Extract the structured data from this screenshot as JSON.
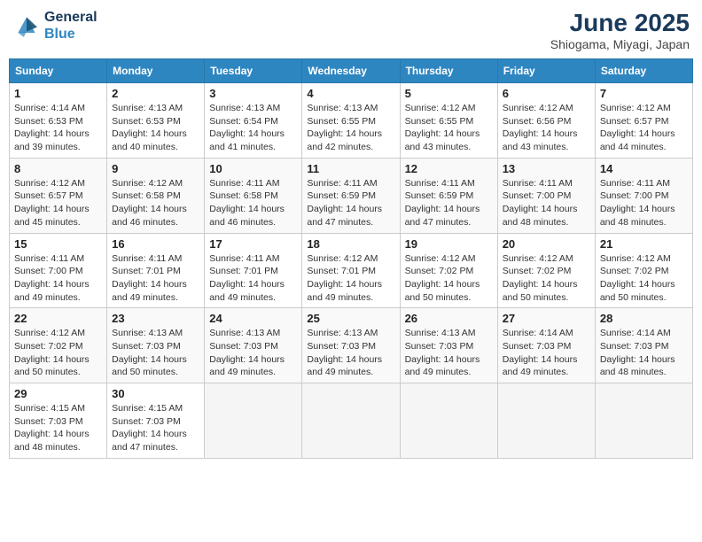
{
  "header": {
    "logo_line1": "General",
    "logo_line2": "Blue",
    "title": "June 2025",
    "subtitle": "Shiogama, Miyagi, Japan"
  },
  "days_of_week": [
    "Sunday",
    "Monday",
    "Tuesday",
    "Wednesday",
    "Thursday",
    "Friday",
    "Saturday"
  ],
  "weeks": [
    [
      {
        "day": "1",
        "info": "Sunrise: 4:14 AM\nSunset: 6:53 PM\nDaylight: 14 hours\nand 39 minutes."
      },
      {
        "day": "2",
        "info": "Sunrise: 4:13 AM\nSunset: 6:53 PM\nDaylight: 14 hours\nand 40 minutes."
      },
      {
        "day": "3",
        "info": "Sunrise: 4:13 AM\nSunset: 6:54 PM\nDaylight: 14 hours\nand 41 minutes."
      },
      {
        "day": "4",
        "info": "Sunrise: 4:13 AM\nSunset: 6:55 PM\nDaylight: 14 hours\nand 42 minutes."
      },
      {
        "day": "5",
        "info": "Sunrise: 4:12 AM\nSunset: 6:55 PM\nDaylight: 14 hours\nand 43 minutes."
      },
      {
        "day": "6",
        "info": "Sunrise: 4:12 AM\nSunset: 6:56 PM\nDaylight: 14 hours\nand 43 minutes."
      },
      {
        "day": "7",
        "info": "Sunrise: 4:12 AM\nSunset: 6:57 PM\nDaylight: 14 hours\nand 44 minutes."
      }
    ],
    [
      {
        "day": "8",
        "info": "Sunrise: 4:12 AM\nSunset: 6:57 PM\nDaylight: 14 hours\nand 45 minutes."
      },
      {
        "day": "9",
        "info": "Sunrise: 4:12 AM\nSunset: 6:58 PM\nDaylight: 14 hours\nand 46 minutes."
      },
      {
        "day": "10",
        "info": "Sunrise: 4:11 AM\nSunset: 6:58 PM\nDaylight: 14 hours\nand 46 minutes."
      },
      {
        "day": "11",
        "info": "Sunrise: 4:11 AM\nSunset: 6:59 PM\nDaylight: 14 hours\nand 47 minutes."
      },
      {
        "day": "12",
        "info": "Sunrise: 4:11 AM\nSunset: 6:59 PM\nDaylight: 14 hours\nand 47 minutes."
      },
      {
        "day": "13",
        "info": "Sunrise: 4:11 AM\nSunset: 7:00 PM\nDaylight: 14 hours\nand 48 minutes."
      },
      {
        "day": "14",
        "info": "Sunrise: 4:11 AM\nSunset: 7:00 PM\nDaylight: 14 hours\nand 48 minutes."
      }
    ],
    [
      {
        "day": "15",
        "info": "Sunrise: 4:11 AM\nSunset: 7:00 PM\nDaylight: 14 hours\nand 49 minutes."
      },
      {
        "day": "16",
        "info": "Sunrise: 4:11 AM\nSunset: 7:01 PM\nDaylight: 14 hours\nand 49 minutes."
      },
      {
        "day": "17",
        "info": "Sunrise: 4:11 AM\nSunset: 7:01 PM\nDaylight: 14 hours\nand 49 minutes."
      },
      {
        "day": "18",
        "info": "Sunrise: 4:12 AM\nSunset: 7:01 PM\nDaylight: 14 hours\nand 49 minutes."
      },
      {
        "day": "19",
        "info": "Sunrise: 4:12 AM\nSunset: 7:02 PM\nDaylight: 14 hours\nand 50 minutes."
      },
      {
        "day": "20",
        "info": "Sunrise: 4:12 AM\nSunset: 7:02 PM\nDaylight: 14 hours\nand 50 minutes."
      },
      {
        "day": "21",
        "info": "Sunrise: 4:12 AM\nSunset: 7:02 PM\nDaylight: 14 hours\nand 50 minutes."
      }
    ],
    [
      {
        "day": "22",
        "info": "Sunrise: 4:12 AM\nSunset: 7:02 PM\nDaylight: 14 hours\nand 50 minutes."
      },
      {
        "day": "23",
        "info": "Sunrise: 4:13 AM\nSunset: 7:03 PM\nDaylight: 14 hours\nand 50 minutes."
      },
      {
        "day": "24",
        "info": "Sunrise: 4:13 AM\nSunset: 7:03 PM\nDaylight: 14 hours\nand 49 minutes."
      },
      {
        "day": "25",
        "info": "Sunrise: 4:13 AM\nSunset: 7:03 PM\nDaylight: 14 hours\nand 49 minutes."
      },
      {
        "day": "26",
        "info": "Sunrise: 4:13 AM\nSunset: 7:03 PM\nDaylight: 14 hours\nand 49 minutes."
      },
      {
        "day": "27",
        "info": "Sunrise: 4:14 AM\nSunset: 7:03 PM\nDaylight: 14 hours\nand 49 minutes."
      },
      {
        "day": "28",
        "info": "Sunrise: 4:14 AM\nSunset: 7:03 PM\nDaylight: 14 hours\nand 48 minutes."
      }
    ],
    [
      {
        "day": "29",
        "info": "Sunrise: 4:15 AM\nSunset: 7:03 PM\nDaylight: 14 hours\nand 48 minutes."
      },
      {
        "day": "30",
        "info": "Sunrise: 4:15 AM\nSunset: 7:03 PM\nDaylight: 14 hours\nand 47 minutes."
      },
      {
        "day": "",
        "info": ""
      },
      {
        "day": "",
        "info": ""
      },
      {
        "day": "",
        "info": ""
      },
      {
        "day": "",
        "info": ""
      },
      {
        "day": "",
        "info": ""
      }
    ]
  ]
}
